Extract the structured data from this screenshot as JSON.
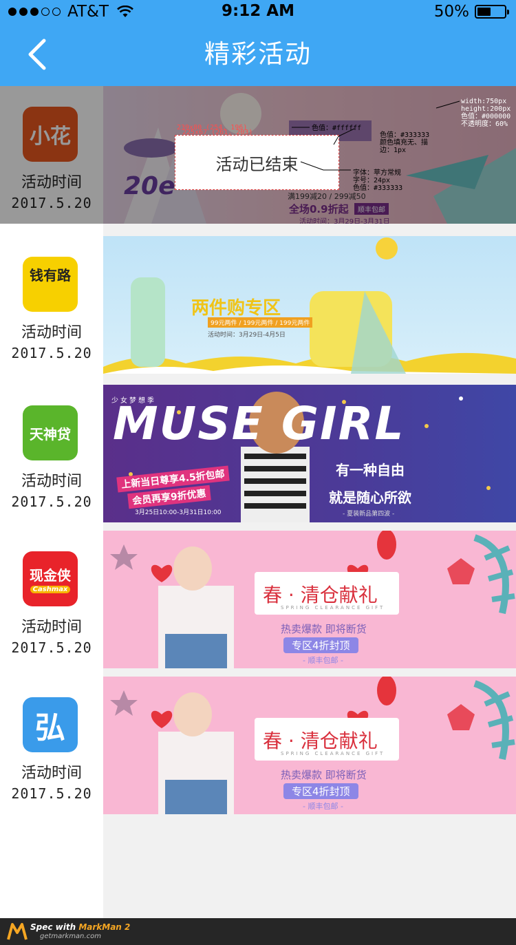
{
  "status_bar": {
    "carrier": "AT&T",
    "time": "9:12 AM",
    "battery": "50%",
    "battery_level": 0.5
  },
  "nav": {
    "title": "精彩活动"
  },
  "activities": [
    {
      "app_name": "小花",
      "label": "活动时间",
      "date": "2017.5.20",
      "logo_color": "#e8571e",
      "status": "活动已结束",
      "banner": {
        "headline": "全场0.9折起",
        "sub": "满199减20 / 299减50",
        "badge": "顺丰包邮",
        "dates": "活动时间：3月29日-3月31日",
        "price": "20e"
      }
    },
    {
      "app_name": "钱有路",
      "label": "活动时间",
      "date": "2017.5.20",
      "logo_color": "#f7d000",
      "banner": {
        "headline": "两件购专区",
        "sub": "99元两件 / 199元两件 / 199元两件",
        "dates": "活动时间：3月29日-4月5日"
      }
    },
    {
      "app_name": "天神贷",
      "label": "活动时间",
      "date": "2017.5.20",
      "logo_color": "#5ab52b",
      "banner": {
        "tag": "少女梦想季",
        "headline": "MUSE GIRL",
        "line1": "上新当日尊享4.5折包邮",
        "line2": "会员再享9折优惠",
        "dates": "3月25日10:00-3月31日10:00",
        "right1": "有一种自由",
        "right2": "就是随心所欲",
        "right3": "- 夏装新品第四波 -"
      }
    },
    {
      "app_name": "现金侠",
      "app_subname": "Cashmax",
      "label": "活动时间",
      "date": "2017.5.20",
      "logo_color": "#e8232a",
      "banner": {
        "headline": "春 · 清仓献礼",
        "eng": "SPRING CLEARANCE GIFT",
        "sub": "热卖爆款 即将断货",
        "pill": "专区4折封顶",
        "foot": "- 顺丰包邮 -"
      }
    },
    {
      "app_name": "弘",
      "label": "活动时间",
      "date": "2017.5.20",
      "logo_color": "#3a9bea",
      "banner": {
        "headline": "春 · 清仓献礼",
        "eng": "SPRING CLEARANCE GIFT",
        "sub": "热卖爆款 即将断货",
        "pill": "专区4折封顶",
        "foot": "- 顺丰包邮 -"
      }
    }
  ],
  "spec_annotations": {
    "box_size": "239x80 (254, 196)",
    "inner_size": "225x67 (261, 203)",
    "box_color": "色值：#ffffff",
    "text_color": "色值：#333333\n颜色填充无、描\n边：1px",
    "font": "字体：苹方常规\n字号：24px\n色值：#333333",
    "overlay": "width:750px\nheight:200px\n色值：#000000\n不透明度：60%"
  },
  "footer": {
    "brand_prefix": "Spec with",
    "brand_name": "MarkMan 2",
    "url": "getmarkman.com"
  }
}
